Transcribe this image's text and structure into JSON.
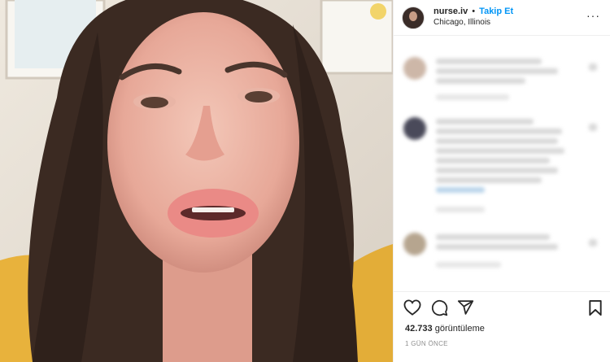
{
  "header": {
    "username": "nurse.iv",
    "separator": "•",
    "follow_label": "Takip Et",
    "location": "Chicago, Illinois"
  },
  "stats": {
    "view_count": "42.733",
    "view_label": "görüntüleme",
    "time_ago": "1 GÜN ÖNCE"
  },
  "colors": {
    "follow": "#0095f6",
    "secondary_text": "#8e8e8e"
  },
  "icons": [
    "more-icon",
    "heart-icon",
    "comment-icon",
    "share-icon",
    "bookmark-icon"
  ]
}
